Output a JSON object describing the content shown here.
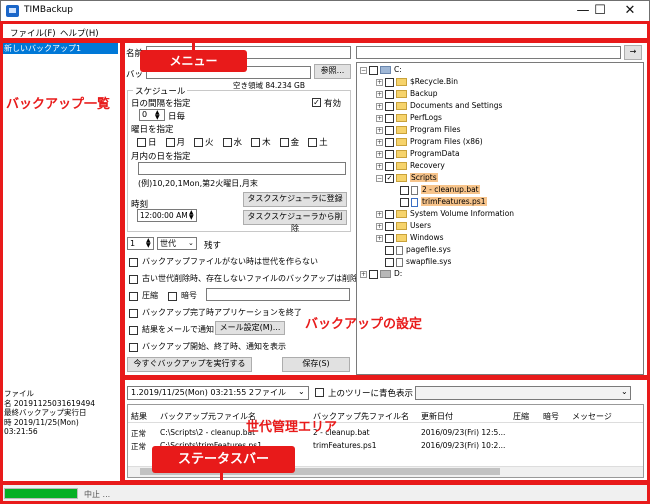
{
  "window": {
    "title": "TIMBackup",
    "min": "—",
    "max": "☐",
    "close": "✕"
  },
  "menu": {
    "file": "ファイル(F)",
    "help": "ヘルプ(H)"
  },
  "sidebar": {
    "items": [
      "新しいバックアップ1"
    ],
    "info_lines": [
      "ファイル",
      "名 20191125031619494",
      "最終バックアップ実行日",
      "時 2019/11/25(Mon)",
      "03:21:56"
    ]
  },
  "settings": {
    "name_label": "名前",
    "name_value": "",
    "dest_label": "バッ",
    "dest_value": "",
    "browse_button": "参照...",
    "free_space": "空き領域 84.234 GB",
    "schedule_title": "スケジュール",
    "interval_label": "日の間隔を指定",
    "enabled_label": "有効",
    "interval_value": "0",
    "interval_unit": "日毎",
    "weekday_label": "曜日を指定",
    "weekdays": [
      "日",
      "月",
      "火",
      "水",
      "木",
      "金",
      "土"
    ],
    "monthday_label": "月内の日を指定",
    "monthday_value": "",
    "monthday_example": "(例)10,20,1Mon,第2火曜日,月末",
    "time_label": "時刻",
    "time_value": "12:00:00 AM",
    "register_button": "タスクスケジューラに登録",
    "unregister_button": "タスクスケジューラから削除",
    "keep_count": "1",
    "keep_unit": "世代",
    "keep_suffix": "残す",
    "options": [
      "バックアップファイルがない時は世代を作らない",
      "古い世代削除時、存在しないファイルのバックアップは削除",
      "バックアップ完了時アプリケーションを終了",
      "結果をメールで通知",
      "バックアップ開始、終了時、通知を表示"
    ],
    "compress_label": "圧縮",
    "encrypt_label": "暗号",
    "mail_button": "メール設定(M)...",
    "run_button": "今すぐバックアップを実行する",
    "save_button": "保存(S)"
  },
  "tree": {
    "path_value": "",
    "go_button": "→",
    "root": "C:",
    "items": [
      "$Recycle.Bin",
      "Backup",
      "Documents and Settings",
      "PerfLogs",
      "Program Files",
      "Program Files (x86)",
      "ProgramData",
      "Recovery",
      "Scripts"
    ],
    "scripts_children": [
      "2 - cleanup.bat",
      "trimFeatures.ps1"
    ],
    "items_after": [
      "System Volume Information",
      "Users",
      "Windows",
      "pagefile.sys",
      "swapfile.sys"
    ],
    "drive_d": "D:"
  },
  "generations": {
    "selected": "1.2019/11/25(Mon) 03:21:55 2ファイル",
    "highlight_label": "上のツリーに青色表示",
    "columns": [
      "結果",
      "バックアップ元ファイル名",
      "バックアップ先ファイル名",
      "更新日付",
      "圧縮",
      "暗号",
      "メッセージ"
    ],
    "rows": [
      [
        "正常",
        "C:\\Scripts\\2 - cleanup.bat",
        "2 - cleanup.bat",
        "2016/09/23(Fri) 12:5..."
      ],
      [
        "正常",
        "C:\\Scripts\\trimFeatures.ps1",
        "trimFeatures.ps1",
        "2016/09/23(Fri) 10:2..."
      ]
    ]
  },
  "status": {
    "progress": 1.0,
    "text": "中止 ..."
  },
  "annotations": {
    "menu": "メニュー",
    "backup_list": "バックアップ一覧",
    "backup_settings": "バックアップの設定",
    "generation_area": "世代管理エリア",
    "status_bar": "ステータスバー"
  },
  "colors": {
    "accent_red": "#e81a1a",
    "progress_green": "#06b025",
    "selection_blue": "#0078d7",
    "highlight_orange": "#f7c48b"
  }
}
